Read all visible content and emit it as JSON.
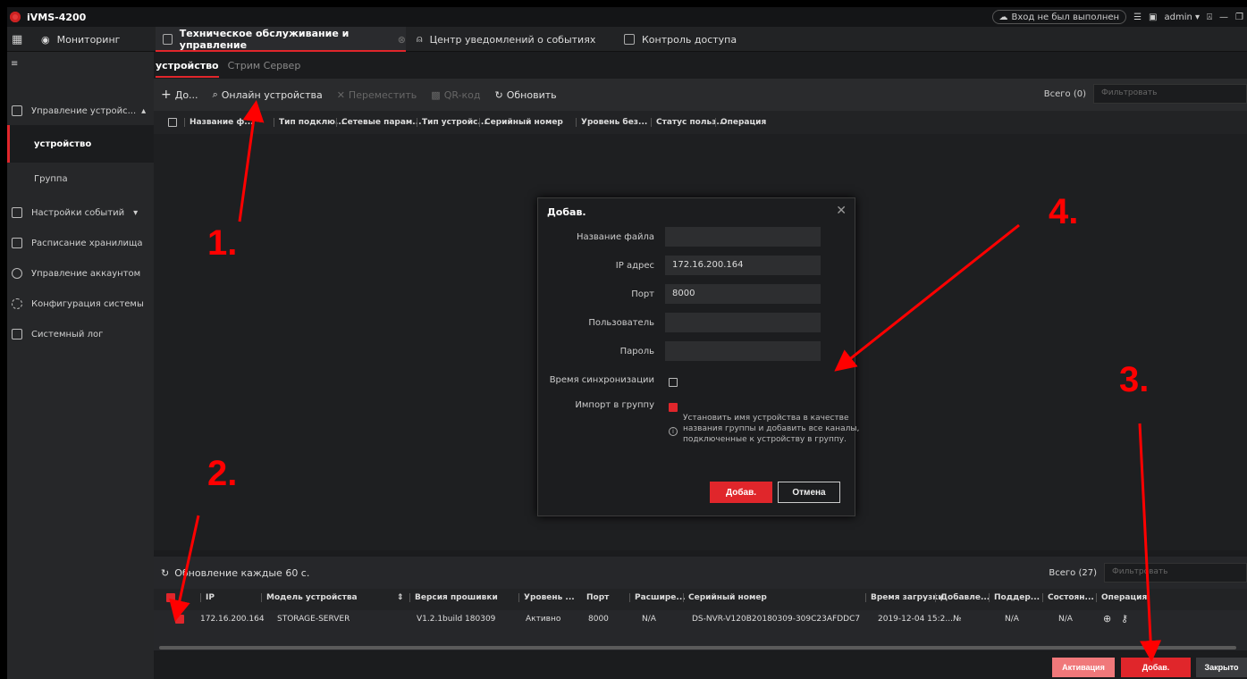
{
  "app": {
    "title": "iVMS-4200"
  },
  "titlebar": {
    "login_status": "Вход не был выполнен",
    "user": "admin"
  },
  "nav": {
    "tabs": [
      {
        "label": "Мониторинг"
      },
      {
        "label": "Техническое обслуживание и управление"
      },
      {
        "label": "Центр уведомлений о событиях"
      },
      {
        "label": "Контроль доступа"
      }
    ]
  },
  "sidebar": {
    "items": [
      {
        "label": "Управление устройс..."
      },
      {
        "label": "устройство"
      },
      {
        "label": "Группа"
      },
      {
        "label": "Настройки событий"
      },
      {
        "label": "Расписание хранилища"
      },
      {
        "label": "Управление аккаунтом"
      },
      {
        "label": "Конфигурация системы"
      },
      {
        "label": "Системный лог"
      }
    ]
  },
  "subtabs": [
    {
      "label": "устройство"
    },
    {
      "label": "Стрим Сервер"
    }
  ],
  "toolbar": {
    "add": "До...",
    "online": "Онлайн устройства",
    "move": "Переместить",
    "qr": "QR-код",
    "refresh": "Обновить",
    "total": "Всего (0)",
    "filter_placeholder": "Фильтровать"
  },
  "device_table": {
    "columns": [
      "Название ф...",
      "Тип подклю...",
      "Сетевые парам...",
      "Тип устройс...",
      "Серийный номер",
      "Уровень без...",
      "Статус польз...",
      "Операция"
    ]
  },
  "dialog": {
    "title": "Добав.",
    "fields": {
      "name_label": "Название файла",
      "name_value": "",
      "ip_label": "IP адрес",
      "ip_value": "172.16.200.164",
      "port_label": "Порт",
      "port_value": "8000",
      "user_label": "Пользователь",
      "user_value": "",
      "password_label": "Пароль",
      "password_value": "",
      "sync_label": "Время синхронизации",
      "import_label": "Импорт в группу"
    },
    "note": "Установить имя устройства в качестве названия группы и добавить все каналы, подключенные к устройству в группу.",
    "add_button": "Добав.",
    "cancel_button": "Отмена"
  },
  "online": {
    "refresh_text": "Обновление каждые 60 с.",
    "total": "Всего (27)",
    "filter_placeholder": "Фильтровать",
    "columns": [
      "IP",
      "Модель устройства",
      "Версия прошивки",
      "Уровень ...",
      "Порт",
      "Расшире...",
      "Серийный номер",
      "Время загрузки",
      "Добавле...",
      "Поддер...",
      "Состоян...",
      "Операция"
    ],
    "rows": [
      {
        "ip": "172.16.200.164",
        "model": "STORAGE-SERVER",
        "firmware": "V1.2.1build 180309",
        "level": "Активно",
        "port": "8000",
        "ext": "N/A",
        "serial": "DS-NVR-V120B20180309-309C23AFDDC7",
        "boot": "2019-12-04 15:2...",
        "added": "№",
        "support": "N/A",
        "state": "N/A"
      }
    ]
  },
  "footer": {
    "activate": "Активация",
    "add": "Добав.",
    "close": "Закрыто"
  },
  "annotations": [
    "1.",
    "2.",
    "3.",
    "4."
  ],
  "colors": {
    "accent": "#e0262b",
    "bg": "#1b1c1e",
    "annotation": "#ff0000"
  }
}
